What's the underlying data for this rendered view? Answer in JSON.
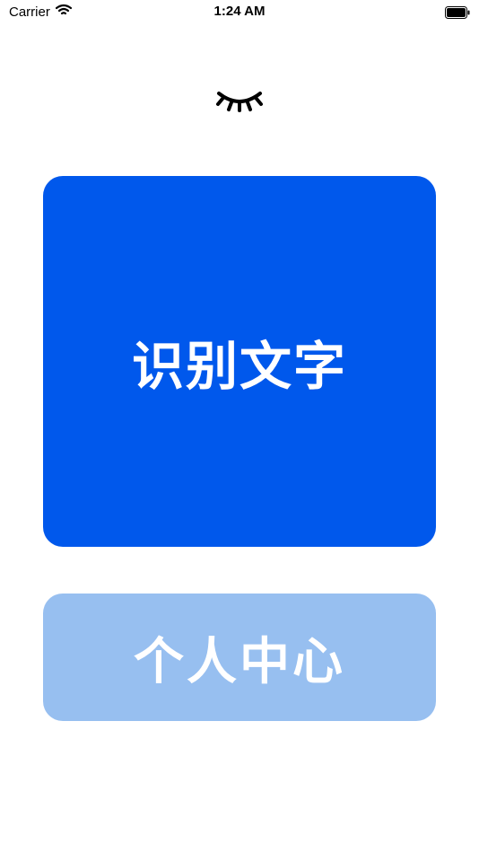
{
  "status_bar": {
    "carrier": "Carrier",
    "time": "1:24 AM",
    "icons": [
      "wifi-icon",
      "battery-icon"
    ]
  },
  "top_icon": "closed-eye-icon",
  "buttons": {
    "recognize_text": "识别文字",
    "profile": "个人中心"
  },
  "colors": {
    "primary_button": "#0058ec",
    "secondary_button": "#97bff0",
    "background": "#ffffff"
  }
}
